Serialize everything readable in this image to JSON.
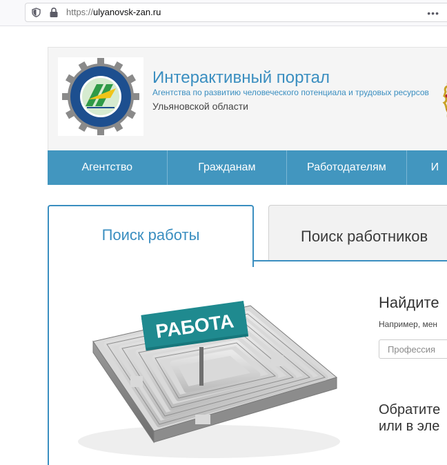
{
  "browser": {
    "url_scheme": "https://",
    "url_host": "ulyanovsk-zan.ru",
    "menu_glyph": "•••"
  },
  "header": {
    "title": "Интерактивный портал",
    "subtitle": "Агентства по развитию человеческого потенциала и трудовых ресурсов",
    "region": "Ульяновской области",
    "logo_ring_text": "АГЕНТСТВО ПО РАЗВИТИЮ ЧЕЛОВЕЧЕСКОГО ПОТЕНЦИАЛА И ТРУДОВЫХ РЕСУРСОВ УЛЬЯНОВСКОЙ ОБЛАСТИ"
  },
  "nav": {
    "items": [
      "Агентство",
      "Гражданам",
      "Работодателям",
      "И"
    ]
  },
  "tabs": {
    "active": "Поиск работы",
    "inactive": "Поиск работников"
  },
  "search": {
    "heading": "Найдите",
    "example": "Например, мен",
    "placeholder": "Профессия",
    "sign_text": "РАБОТА"
  },
  "contact": {
    "line1": "Обратите",
    "line2": "или в эле"
  },
  "colors": {
    "accent": "#3a8ec0",
    "nav_bg": "#4296bf",
    "sign": "#1f8a8f"
  },
  "icons": [
    "shield-icon",
    "lock-icon",
    "more-dots-icon",
    "site-logo",
    "coat-of-arms-icon"
  ]
}
